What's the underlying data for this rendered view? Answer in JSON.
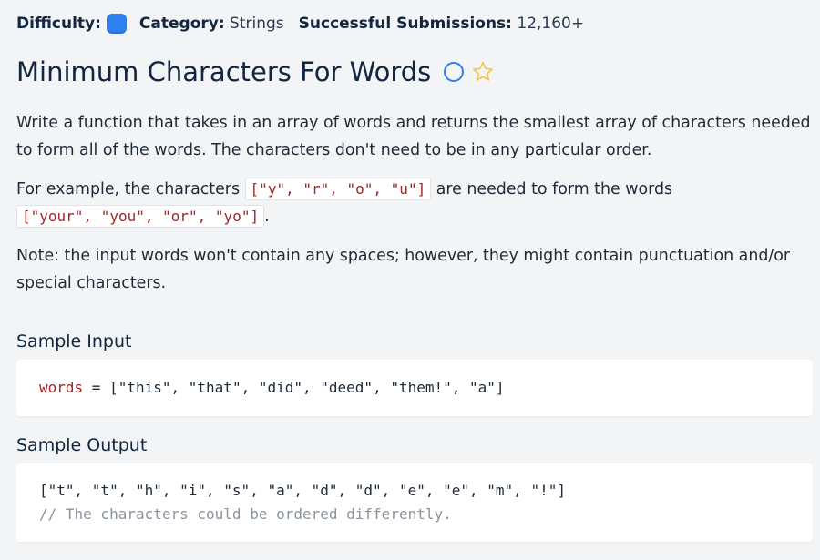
{
  "meta": {
    "difficulty_label": "Difficulty:",
    "category_label": "Category:",
    "category_value": "Strings",
    "submissions_label": "Successful Submissions:",
    "submissions_value": "12,160+"
  },
  "problem": {
    "title": "Minimum Characters For Words"
  },
  "description": {
    "p1": "Write a function that takes in an array of words and returns the smallest array of characters needed to form all of the words. The characters don't need to be in any particular order.",
    "p2_before": "For example, the characters ",
    "p2_code1": "[\"y\", \"r\", \"o\", \"u\"]",
    "p2_middle": " are needed to form the words ",
    "p2_code2": "[\"your\", \"you\", \"or\", \"yo\"]",
    "p2_after": ".",
    "p3": "Note: the input words won't contain any spaces; however, they might contain punctuation and/or special characters."
  },
  "sample_input": {
    "heading": "Sample Input",
    "var_name": "words",
    "assign": " = ",
    "value": "[\"this\", \"that\", \"did\", \"deed\", \"them!\", \"a\"]"
  },
  "sample_output": {
    "heading": "Sample Output",
    "line1": "[\"t\", \"t\", \"h\", \"i\", \"s\", \"a\", \"d\", \"d\", \"e\", \"e\", \"m\", \"!\"]",
    "line2": "// The characters could be ordered differently."
  },
  "colors": {
    "difficulty_badge": "#2f80ed",
    "star": "#f2c94c",
    "status_circle": "#2f80ed",
    "code_red": "#a02727"
  },
  "icons": {
    "difficulty": "difficulty-badge-icon",
    "status": "circle-status-icon",
    "favorite": "star-icon"
  }
}
